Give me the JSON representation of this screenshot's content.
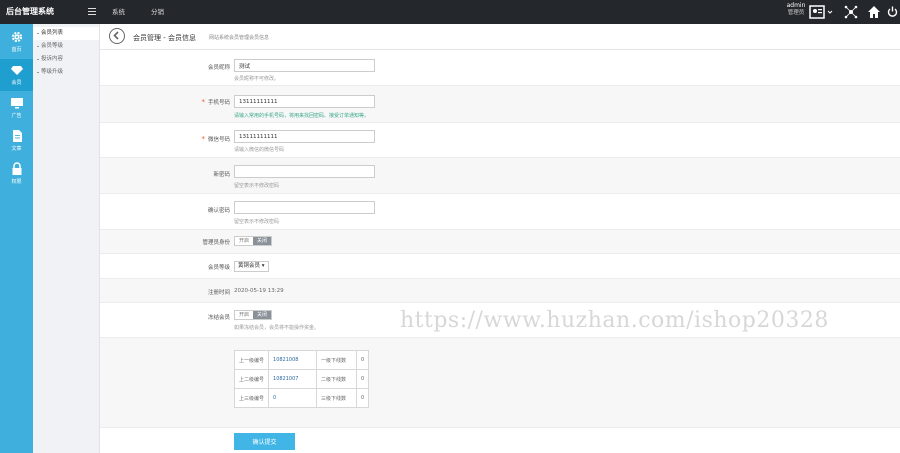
{
  "topbar": {
    "brand": "后台管理系统",
    "nav": [
      "系统",
      "分销"
    ],
    "user": {
      "name": "admin",
      "role": "管理员"
    }
  },
  "sidebar": {
    "items": [
      {
        "label": "首页",
        "icon": "gear-icon"
      },
      {
        "label": "会员",
        "icon": "diamond-icon",
        "active": true
      },
      {
        "label": "广告",
        "icon": "monitor-icon"
      },
      {
        "label": "文章",
        "icon": "document-icon"
      },
      {
        "label": "权限",
        "icon": "lock-icon"
      }
    ]
  },
  "submenu": {
    "items": [
      "会员列表",
      "会员等级",
      "投诉内容",
      "等级升级"
    ]
  },
  "page": {
    "title": "会员管理 - 会员信息",
    "subtitle": "网站系统会员管理会员信息"
  },
  "form": {
    "nickname": {
      "label": "会员昵称",
      "value": "测试",
      "hint": "会员昵称不可修改。"
    },
    "phone": {
      "label": "手机号码",
      "value": "13111111111",
      "hint": "请输入常用的手机号码，将用来找回密码、接受订单通知等。"
    },
    "wechat": {
      "label": "微信号码",
      "value": "13111111111",
      "hint": "请输入微信的微信号码"
    },
    "new_password": {
      "label": "新密码",
      "value": "",
      "hint": "留空表示不修改密码"
    },
    "confirm_password": {
      "label": "确认密码",
      "value": "",
      "hint": "留空表示不修改密码"
    },
    "admin_role": {
      "label": "管理员身份",
      "on": "开启",
      "off": "关闭"
    },
    "level": {
      "label": "会员等级",
      "value": "黄铜会员"
    },
    "reg_time": {
      "label": "注册时间",
      "value": "2020-05-19 13:29"
    },
    "freeze": {
      "label": "冻结会员",
      "on": "开启",
      "off": "关闭",
      "hint": "如果冻结会员，会员将不能操作资金。"
    },
    "relations": [
      {
        "k1": "上一级编号",
        "v1": "10821008",
        "k2": "一级下线数",
        "v2": "0"
      },
      {
        "k1": "上二级编号",
        "v1": "10821007",
        "k2": "二级下线数",
        "v2": "0"
      },
      {
        "k1": "上三级编号",
        "v1": "0",
        "k2": "三级下线数",
        "v2": "0"
      }
    ],
    "submit": "确认提交"
  },
  "watermark": "https://www.huzhan.com/ishop20328"
}
